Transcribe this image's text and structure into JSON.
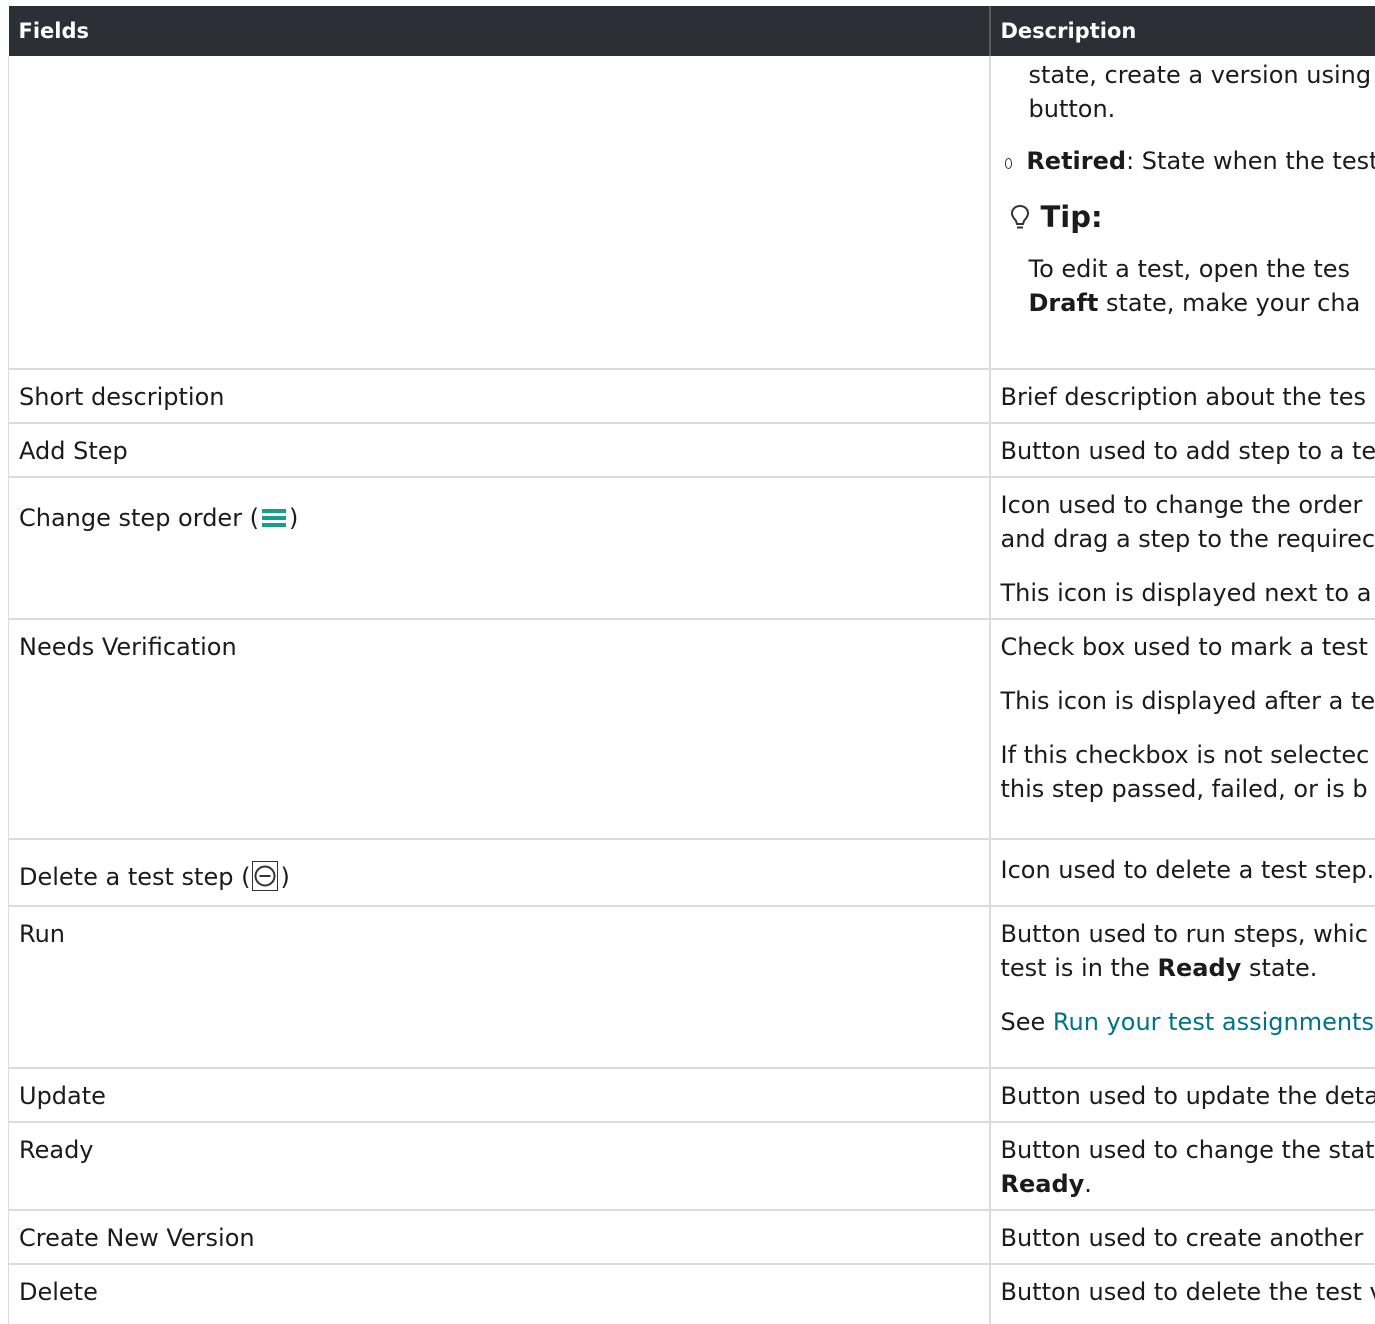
{
  "header": {
    "col_fields": "Fields",
    "col_description": "Description"
  },
  "state_row": {
    "line1": "state, create a version using",
    "line2": "button.",
    "retired_bold": "Retired",
    "retired_rest": ": State when the test",
    "tip_title": "Tip:",
    "tip_line1": "To edit a test, open the tes",
    "tip_line2_bold": "Draft",
    "tip_line2_rest": " state, make your cha"
  },
  "rows": [
    {
      "field": "Short description",
      "desc": "Brief description about the tes"
    },
    {
      "field": "Add Step",
      "desc": "Button used to add step to a te"
    },
    {
      "field_pre": "Change step order (",
      "field_post": ")",
      "icon": "menu-icon",
      "desc_line1": "Icon used to change the order",
      "desc_line2": "and drag a step to the requirec",
      "desc_para2": "This icon is displayed next to a"
    },
    {
      "field": "Needs Verification",
      "desc_para1": "Check box used to mark a test",
      "desc_para2": "This icon is displayed after a te",
      "desc_para3_line1": "If this checkbox is not selectec",
      "desc_para3_line2": "this step passed, failed, or is b"
    },
    {
      "field_pre": "Delete a test step (",
      "field_post": ")",
      "icon": "minus-circle-icon",
      "desc": "Icon used to delete a test step."
    },
    {
      "field": "Run",
      "desc_line1": "Button used to run steps, whic",
      "desc_line2_pre": "test is in the ",
      "desc_line2_bold": "Ready",
      "desc_line2_post": " state.",
      "see_pre": "See ",
      "see_link": "Run your test assignments"
    },
    {
      "field": "Update",
      "desc": "Button used to update the deta"
    },
    {
      "field": "Ready",
      "desc_line1": "Button used to change the stat",
      "desc_line2_bold": "Ready",
      "desc_line2_post": "."
    },
    {
      "field": "Create New Version",
      "desc": "Button used to create another"
    },
    {
      "field": "Delete",
      "desc": "Button used to delete the test v"
    }
  ],
  "colors": {
    "header_bg": "#2d2f36",
    "link": "#00728a",
    "icon_teal": "#1a9c8a"
  }
}
